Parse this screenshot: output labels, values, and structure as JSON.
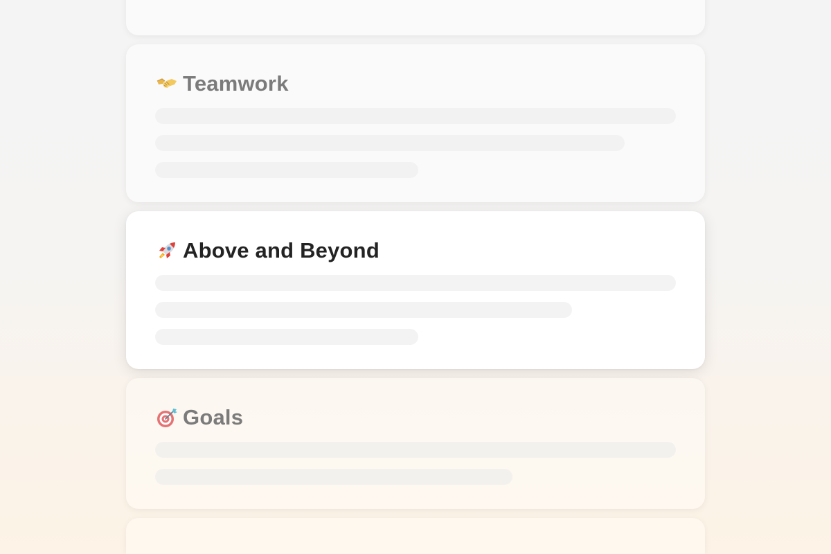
{
  "cards": [
    {
      "title": "",
      "emoji_icon": "none",
      "state": "dim"
    },
    {
      "title": "Teamwork",
      "emoji_icon": "handshake-icon",
      "state": "dim"
    },
    {
      "title": "Above and Beyond",
      "emoji_icon": "rocket-icon",
      "state": "active"
    },
    {
      "title": "Goals",
      "emoji_icon": "target-icon",
      "state": "faded"
    },
    {
      "title": "",
      "emoji_icon": "none",
      "state": "faded"
    }
  ],
  "colors": {
    "title_active": "#232323",
    "title_dim": "#7b7b7b",
    "placeholder_bar": "#f2f2f2",
    "background_warm": "#fdf3e6"
  }
}
